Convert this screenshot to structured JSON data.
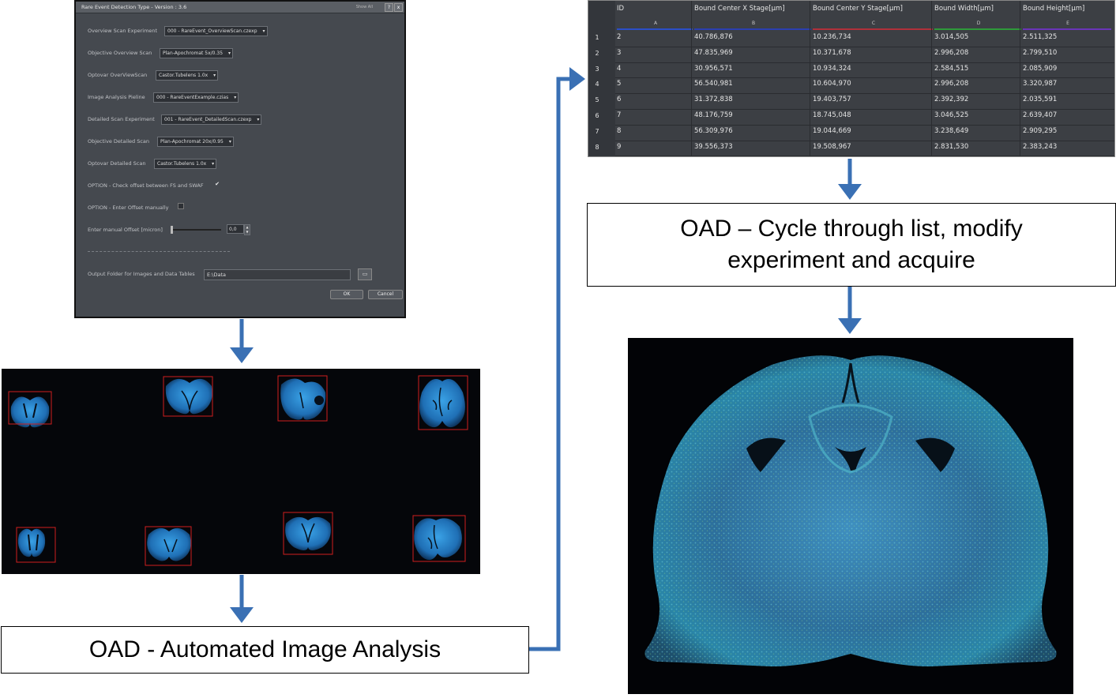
{
  "dialog": {
    "title": "Rare Event Detection Type - Version : 3.6",
    "show_all": "Show All",
    "help_btn": "?",
    "close_btn": "x",
    "rows": [
      {
        "label": "Overview Scan Experiment",
        "value": "000 - RareEvent_OverviewScan.czexp"
      },
      {
        "label": "Objective Overview Scan",
        "value": "Plan-Apochromat 5x/0.35"
      },
      {
        "label": "Optovar OverViewScan",
        "value": "Castor.Tubelens 1.0x"
      },
      {
        "label": "Image Analysis Pieline",
        "value": "000 - RareEventExample.czias"
      },
      {
        "label": "Detailed Scan Experiment",
        "value": "001 - RareEvent_DetailedScan.czexp"
      },
      {
        "label": "Objective Detailed Scan",
        "value": "Plan-Apochromat 20x/0.95"
      },
      {
        "label": "Optovar Detailed Scan",
        "value": "Castor.Tubelens 1.0x"
      }
    ],
    "option_check_label": "OPTION - Check offset between FS and SWAF",
    "option_check_checked": true,
    "option_manual_label": "OPTION - Enter Offset manually",
    "option_manual_checked": false,
    "offset_label": "Enter manual Offset [micron]",
    "offset_value": "0,0",
    "offset_slider_fraction": 0.0,
    "output_label": "Output Folder for Images and Data Tables",
    "output_value": "E:\\Data",
    "ok_label": "OK",
    "cancel_label": "Cancel"
  },
  "table": {
    "headers": [
      "ID",
      "Bound Center X Stage[µm]",
      "Bound Center Y Stage[µm]",
      "Bound Width[µm]",
      "Bound Height[µm]"
    ],
    "column_letters": [
      "A",
      "B",
      "C",
      "D",
      "E"
    ],
    "column_colors": [
      "#2b4fc8",
      "#2b3fb0",
      "#b0303a",
      "#2e9a3a",
      "#6a34b8"
    ],
    "rows": [
      {
        "n": "1",
        "cells": [
          "2",
          "40.786,876",
          "10.236,734",
          "3.014,505",
          "2.511,325"
        ]
      },
      {
        "n": "2",
        "cells": [
          "3",
          "47.835,969",
          "10.371,678",
          "2.996,208",
          "2.799,510"
        ]
      },
      {
        "n": "3",
        "cells": [
          "4",
          "30.956,571",
          "10.934,324",
          "2.584,515",
          "2.085,909"
        ]
      },
      {
        "n": "4",
        "cells": [
          "5",
          "56.540,981",
          "10.604,970",
          "2.996,208",
          "3.320,987"
        ]
      },
      {
        "n": "5",
        "cells": [
          "6",
          "31.372,838",
          "19.403,757",
          "2.392,392",
          "2.035,591"
        ]
      },
      {
        "n": "6",
        "cells": [
          "7",
          "48.176,759",
          "18.745,048",
          "3.046,525",
          "2.639,407"
        ]
      },
      {
        "n": "7",
        "cells": [
          "8",
          "56.309,976",
          "19.044,669",
          "3.238,649",
          "2.909,295"
        ]
      },
      {
        "n": "8",
        "cells": [
          "9",
          "39.556,373",
          "19.508,967",
          "2.831,530",
          "2.383,243"
        ]
      }
    ]
  },
  "boxes": {
    "analysis": "OAD - Automated Image Analysis",
    "cycle_line1": "OAD – Cycle through list, modify",
    "cycle_line2": "experiment and acquire"
  },
  "colors": {
    "arrow": "#3a70b4",
    "detection_box": "#d01f1f",
    "tissue": "#2f8fd6"
  }
}
